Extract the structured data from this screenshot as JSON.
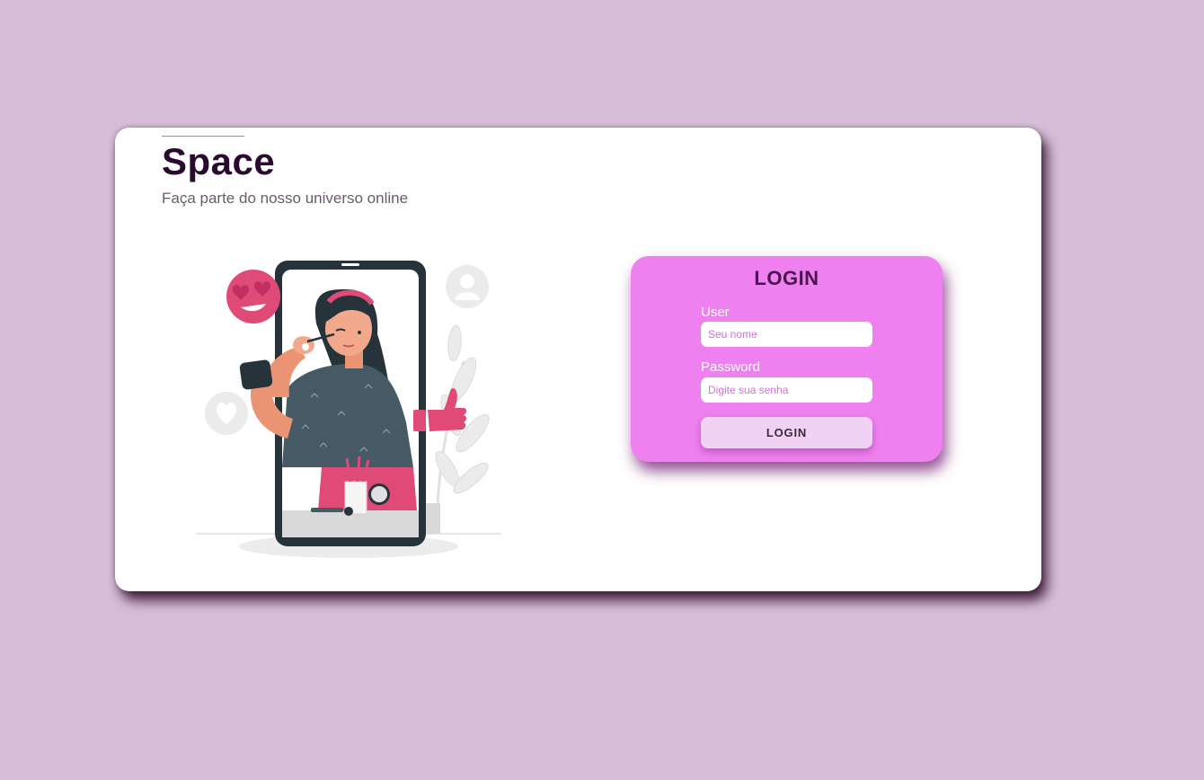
{
  "brand": {
    "title": "Space",
    "subtitle": "Faça parte do nosso universo online"
  },
  "login": {
    "title": "LOGIN",
    "user_label": "User",
    "user_placeholder": "Seu nome",
    "user_value": "",
    "password_label": "Password",
    "password_placeholder": "Digite sua senha",
    "password_value": "",
    "button_label": "LOGIN"
  },
  "colors": {
    "page_background": "#d7bed8",
    "card_background": "#ffffff",
    "login_box": "#ee80ef",
    "login_button": "#f2d2f4",
    "title_text": "#2a0a2e",
    "accent_pink": "#e04a77",
    "phone_frame": "#26333a"
  },
  "illustration": {
    "icons": [
      "phone-icon",
      "woman-applying-makeup",
      "heart-eyes-emoji-icon",
      "heart-icon",
      "user-avatar-icon",
      "thumbs-up-icon",
      "plant-icon"
    ]
  }
}
